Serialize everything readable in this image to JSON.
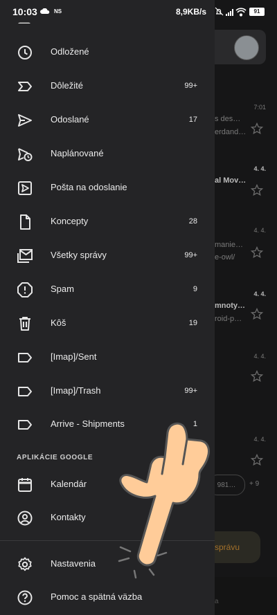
{
  "status_bar": {
    "time": "10:03",
    "ns_label": "NS",
    "net_speed": "8,9KB/s",
    "battery": "91"
  },
  "background": {
    "avatar_text": "",
    "rows": [
      {
        "date": "7:01",
        "line1": "s des…",
        "line2": "erdand…",
        "bold": false
      },
      {
        "date": "4. 4.",
        "line1": "al Mov…",
        "line2": "",
        "bold": true
      },
      {
        "date": "4. 4.",
        "line1": "manie…",
        "line2": "e-owl/",
        "bold": false
      },
      {
        "date": "4. 4.",
        "line1": "mnoty…",
        "line2": "roid-p…",
        "bold": true
      },
      {
        "date": "4. 4.",
        "line1": "",
        "line2": "",
        "bold": false
      },
      {
        "date": "4. 4.",
        "line1": "",
        "line2": "",
        "bold": false
      }
    ],
    "chip_text": "981…",
    "chip_plus": "+ 9",
    "compose_label": "správu"
  },
  "drawer": {
    "items": [
      {
        "name": "snoozed",
        "label": "Odložené",
        "count": "",
        "icon": "clock-icon"
      },
      {
        "name": "important",
        "label": "Dôležité",
        "count": "99+",
        "icon": "important-icon"
      },
      {
        "name": "sent",
        "label": "Odoslané",
        "count": "17",
        "icon": "send-icon"
      },
      {
        "name": "scheduled",
        "label": "Naplánované",
        "count": "",
        "icon": "scheduled-send-icon"
      },
      {
        "name": "outbox",
        "label": "Pošta na odoslanie",
        "count": "",
        "icon": "outbox-icon"
      },
      {
        "name": "drafts",
        "label": "Koncepty",
        "count": "28",
        "icon": "draft-icon"
      },
      {
        "name": "all-mail",
        "label": "Všetky správy",
        "count": "99+",
        "icon": "all-mail-icon"
      },
      {
        "name": "spam",
        "label": "Spam",
        "count": "9",
        "icon": "spam-icon"
      },
      {
        "name": "trash",
        "label": "Kôš",
        "count": "19",
        "icon": "trash-icon"
      },
      {
        "name": "imap-sent",
        "label": "[Imap]/Sent",
        "count": "",
        "icon": "label-icon"
      },
      {
        "name": "imap-trash",
        "label": "[Imap]/Trash",
        "count": "99+",
        "icon": "label-icon"
      },
      {
        "name": "arrive-shipments",
        "label": "Arrive - Shipments",
        "count": "1",
        "icon": "label-icon"
      }
    ],
    "google_apps_title": "APLIKÁCIE GOOGLE",
    "google_apps": [
      {
        "name": "calendar",
        "label": "Kalendár",
        "icon": "calendar-icon"
      },
      {
        "name": "contacts",
        "label": "Kontakty",
        "icon": "contacts-icon"
      }
    ],
    "bottom": [
      {
        "name": "settings",
        "label": "Nastavenia",
        "icon": "gear-icon"
      },
      {
        "name": "help",
        "label": "Pomoc a spätná väzba",
        "icon": "help-icon"
      }
    ]
  },
  "colors": {
    "drawer_bg": "#242426",
    "accent_hand": "#ffcc99"
  }
}
